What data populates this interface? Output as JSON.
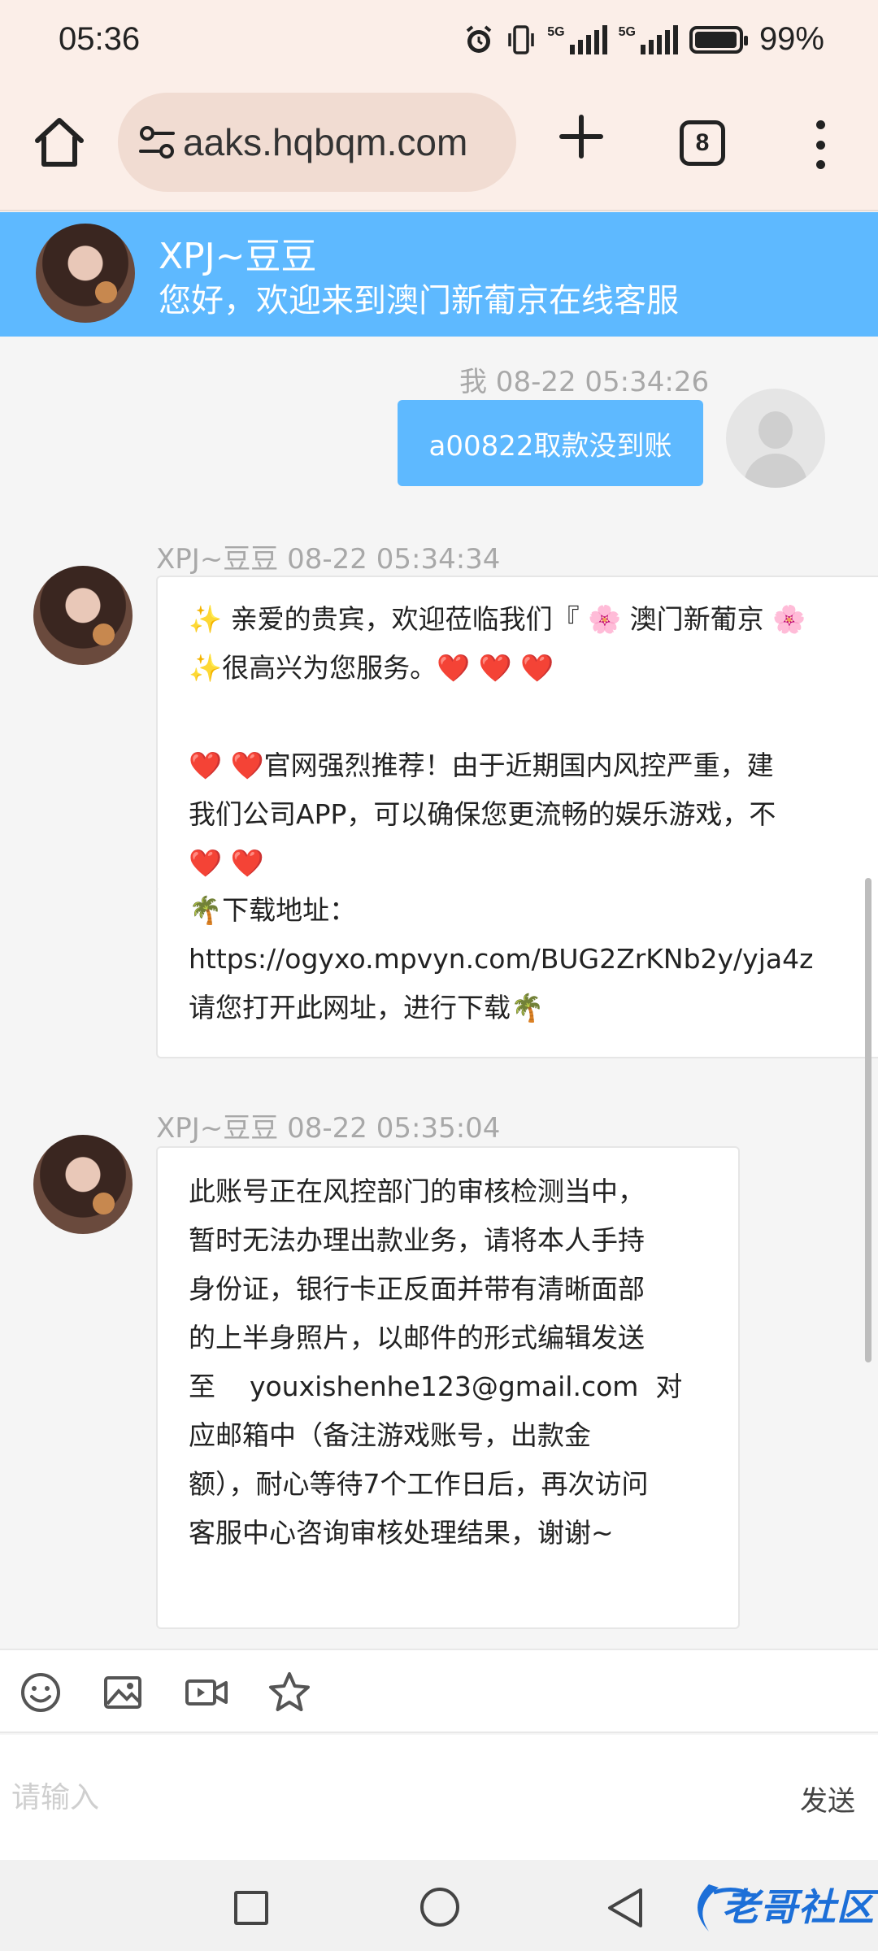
{
  "status_bar": {
    "time": "05:36",
    "battery": "99%",
    "net1": "5G",
    "net2": "5G",
    "battery_level": 0.99
  },
  "browser": {
    "url": "aaks.hqbqm.com",
    "tab_count": "8"
  },
  "chat_header": {
    "agent_name": "XPJ~豆豆",
    "subtitle": "您好，欢迎来到澳门新葡京在线客服"
  },
  "messages": [
    {
      "sender": "我",
      "time": "08-22 05:34:26",
      "meta": "我 08-22 05:34:26",
      "text": "a00822取款没到账"
    },
    {
      "sender": "XPJ~豆豆",
      "meta": "XPJ~豆豆  08-22 05:34:34",
      "lines": [
        "✨ 亲爱的贵宾，欢迎莅临我们『 🌸 澳门新葡京 🌸",
        "✨很高兴为您服务。❤️ ❤️ ❤️",
        "",
        "❤️ ❤️官网强烈推荐！由于近期国内风控严重，建",
        "我们公司APP，可以确保您更流畅的娱乐游戏，不",
        "❤️ ❤️",
        "🌴下载地址：",
        "https://ogyxo.mpvyn.com/BUG2ZrKNb2y/yja4z",
        "请您打开此网址，进行下载🌴"
      ]
    },
    {
      "sender": "XPJ~豆豆",
      "meta": "XPJ~豆豆  08-22 05:35:04",
      "lines": [
        "此账号正在风控部门的审核检测当中，",
        "暂时无法办理出款业务，请将本人手持",
        "身份证，银行卡正反面并带有清晰面部",
        "的上半身照片，以邮件的形式编辑发送",
        "至    youxishenhe123@gmail.com  对",
        "应邮箱中（备注游戏账号，出款金",
        "额），耐心等待7个工作日后，再次访问",
        "客服中心咨询审核处理结果，谢谢~"
      ]
    }
  ],
  "toolbar": {
    "icons": [
      "emoji-icon",
      "image-icon",
      "video-icon",
      "star-icon"
    ]
  },
  "input": {
    "placeholder": "请输入",
    "send_label": "发送"
  },
  "watermark": {
    "text": "老哥社区"
  },
  "colors": {
    "header_blue": "#5eb9ff",
    "user_bubble": "#5eb9ff",
    "browser_bg": "#fbeee8"
  }
}
